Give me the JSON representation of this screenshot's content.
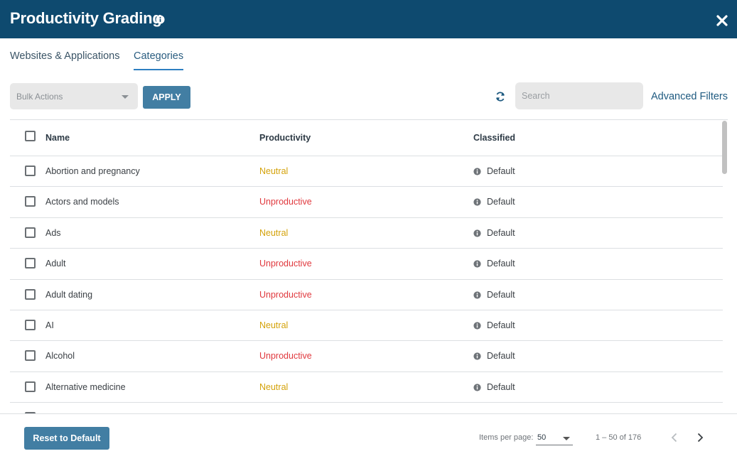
{
  "header": {
    "title": "Productivity Grading",
    "bg_color": "#0e4a6f"
  },
  "tabs": [
    {
      "label": "Websites & Applications",
      "active": false
    },
    {
      "label": "Categories",
      "active": true
    }
  ],
  "toolbar": {
    "bulk_actions_placeholder": "Bulk Actions",
    "apply_label": "APPLY",
    "search_placeholder": "Search",
    "advanced_filters_label": "Advanced Filters"
  },
  "table": {
    "columns": {
      "name": "Name",
      "productivity": "Productivity",
      "classified": "Classified"
    },
    "rows": [
      {
        "name": "Abortion and pregnancy",
        "productivity": "Neutral",
        "classified": "Default"
      },
      {
        "name": "Actors and models",
        "productivity": "Unproductive",
        "classified": "Default"
      },
      {
        "name": "Ads",
        "productivity": "Neutral",
        "classified": "Default"
      },
      {
        "name": "Adult",
        "productivity": "Unproductive",
        "classified": "Default"
      },
      {
        "name": "Adult dating",
        "productivity": "Unproductive",
        "classified": "Default"
      },
      {
        "name": "AI",
        "productivity": "Neutral",
        "classified": "Default"
      },
      {
        "name": "Alcohol",
        "productivity": "Unproductive",
        "classified": "Default"
      },
      {
        "name": "Alternative medicine",
        "productivity": "Neutral",
        "classified": "Default"
      },
      {
        "name": "",
        "productivity": "",
        "classified": ""
      }
    ]
  },
  "colors": {
    "neutral": "#d4a20a",
    "unproductive": "#e0393e",
    "accent_button": "#427ea3"
  },
  "footer": {
    "reset_label": "Reset to Default",
    "items_per_page_label": "Items per page:",
    "items_per_page_value": "50",
    "range_label": "1 – 50 of 176"
  }
}
